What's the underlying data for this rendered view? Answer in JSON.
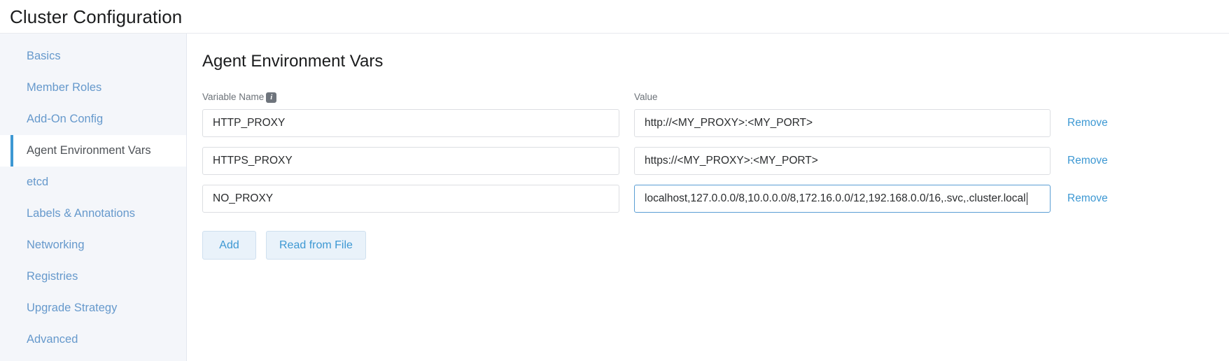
{
  "header": {
    "title": "Cluster Configuration"
  },
  "sidebar": {
    "items": [
      {
        "label": "Basics",
        "active": false
      },
      {
        "label": "Member Roles",
        "active": false
      },
      {
        "label": "Add-On Config",
        "active": false
      },
      {
        "label": "Agent Environment Vars",
        "active": true
      },
      {
        "label": "etcd",
        "active": false
      },
      {
        "label": "Labels & Annotations",
        "active": false
      },
      {
        "label": "Networking",
        "active": false
      },
      {
        "label": "Registries",
        "active": false
      },
      {
        "label": "Upgrade Strategy",
        "active": false
      },
      {
        "label": "Advanced",
        "active": false
      }
    ]
  },
  "main": {
    "section_title": "Agent Environment Vars",
    "columns": {
      "name_label": "Variable Name",
      "name_info_icon": "info-icon",
      "value_label": "Value"
    },
    "rows": [
      {
        "name": "HTTP_PROXY",
        "value": "http://<MY_PROXY>:<MY_PORT>",
        "remove_label": "Remove",
        "focused": false
      },
      {
        "name": "HTTPS_PROXY",
        "value": "https://<MY_PROXY>:<MY_PORT>",
        "remove_label": "Remove",
        "focused": false
      },
      {
        "name": "NO_PROXY",
        "value": "localhost,127.0.0.0/8,10.0.0.0/8,172.16.0.0/12,192.168.0.0/16,.svc,.cluster.local",
        "remove_label": "Remove",
        "focused": true
      }
    ],
    "buttons": {
      "add_label": "Add",
      "read_from_file_label": "Read from File"
    }
  },
  "colors": {
    "link_blue": "#3d98d3",
    "sidebar_bg": "#f4f6fa",
    "active_border": "#3d98d3",
    "button_bg": "#e9f2fa",
    "focus_border": "#5a9ed4",
    "info_icon_bg": "#6e747c"
  }
}
